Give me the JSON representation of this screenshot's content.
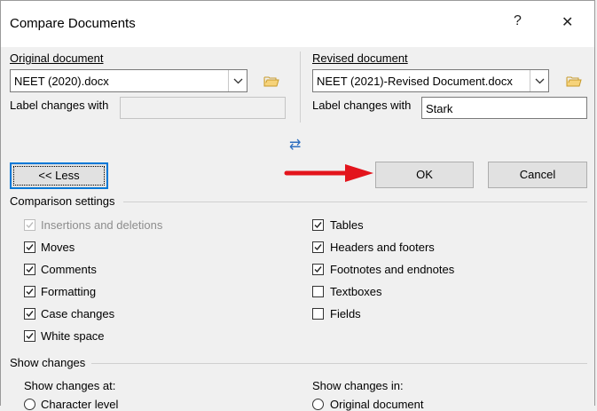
{
  "dialog": {
    "title": "Compare Documents",
    "help_glyph": "?",
    "close_glyph": "✕"
  },
  "original": {
    "heading": "Original document",
    "value": "NEET (2020).docx",
    "label_changes_with": "Label changes with",
    "label_value": ""
  },
  "revised": {
    "heading": "Revised document",
    "value": "NEET (2021)-Revised Document.docx",
    "label_changes_with": "Label changes with",
    "label_value": "Stark"
  },
  "swap_glyph": "⇄",
  "buttons": {
    "less": "<< Less",
    "ok": "OK",
    "cancel": "Cancel"
  },
  "comparison": {
    "heading": "Comparison settings",
    "left": [
      {
        "label": "Insertions and deletions",
        "checked": true,
        "disabled": true
      },
      {
        "label": "Moves",
        "checked": true,
        "disabled": false
      },
      {
        "label": "Comments",
        "checked": true,
        "disabled": false
      },
      {
        "label": "Formatting",
        "checked": true,
        "disabled": false
      },
      {
        "label": "Case changes",
        "checked": true,
        "disabled": false
      },
      {
        "label": "White space",
        "checked": true,
        "disabled": false
      }
    ],
    "right": [
      {
        "label": "Tables",
        "checked": true,
        "disabled": false
      },
      {
        "label": "Headers and footers",
        "checked": true,
        "disabled": false
      },
      {
        "label": "Footnotes and endnotes",
        "checked": true,
        "disabled": false
      },
      {
        "label": "Textboxes",
        "checked": false,
        "disabled": false
      },
      {
        "label": "Fields",
        "checked": false,
        "disabled": false
      }
    ]
  },
  "show_changes": {
    "heading": "Show changes",
    "at_label": "Show changes at:",
    "in_label": "Show changes in:",
    "at_option": "Character level",
    "in_option": "Original document"
  },
  "colors": {
    "accent": "#0078d7",
    "arrow": "#e3141c"
  }
}
